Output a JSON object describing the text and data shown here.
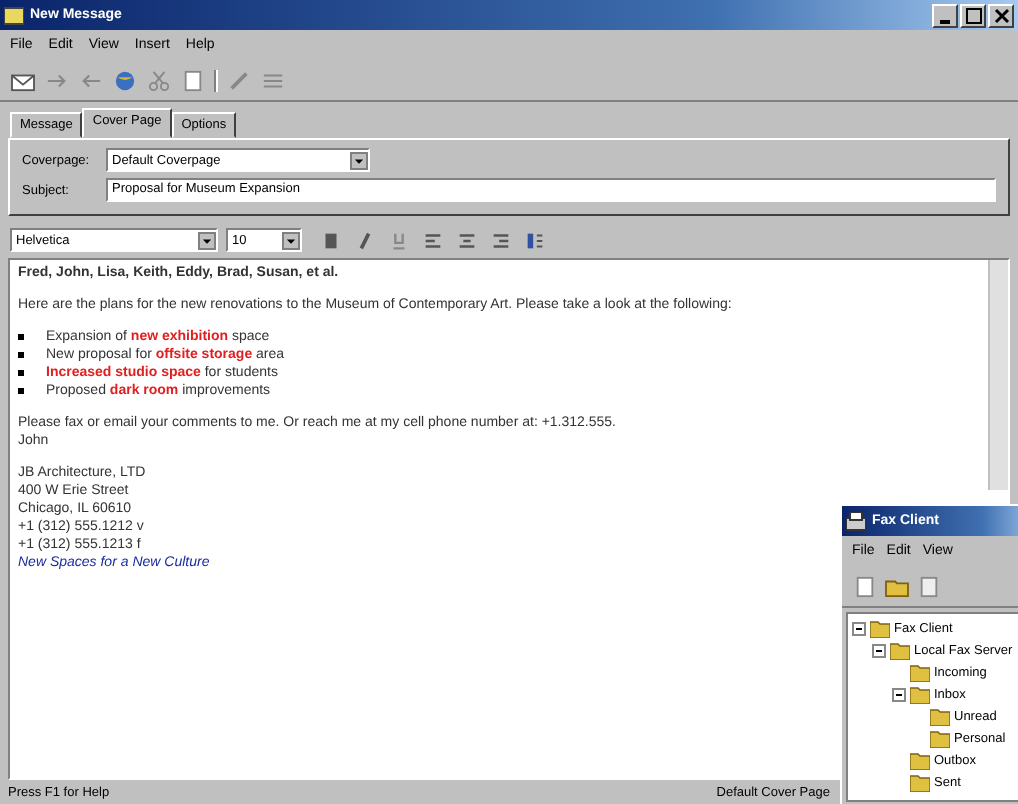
{
  "window": {
    "title": "New Message"
  },
  "menu": [
    "File",
    "Edit",
    "View",
    "Insert",
    "Help"
  ],
  "tabs": [
    {
      "label": "Message",
      "selected": false
    },
    {
      "label": "Cover Page",
      "selected": true
    },
    {
      "label": "Options",
      "selected": false
    }
  ],
  "cover_page": {
    "label": "Coverpage:",
    "value": "Default Coverpage"
  },
  "subject": {
    "label": "Subject:",
    "value": "Proposal for Museum Expansion"
  },
  "format_bar": {
    "font": "Helvetica",
    "size": "10"
  },
  "body": {
    "greeting": "Fred, John, Lisa, Keith, Eddy, Brad, Susan, et al.",
    "intro": "Here are the plans for the new renovations to the Museum of Contemporary Art. Please take a look at the following:",
    "bullets": [
      [
        {
          "text": "Expansion of ",
          "highlight": false
        },
        {
          "text": "new exhibition",
          "highlight": true
        },
        {
          "text": " space",
          "highlight": false
        }
      ],
      [
        {
          "text": "New proposal for ",
          "highlight": false
        },
        {
          "text": "offsite storage",
          "highlight": true
        },
        {
          "text": " area",
          "highlight": false
        }
      ],
      [
        {
          "text": "Increased studio space",
          "highlight": true
        },
        {
          "text": " for students",
          "highlight": false
        }
      ],
      [
        {
          "text": "Proposed ",
          "highlight": false
        },
        {
          "text": "dark room",
          "highlight": true
        },
        {
          "text": " improvements",
          "highlight": false
        }
      ]
    ],
    "closing": "Please fax or email your comments to me. Or reach me at my cell phone number at: +1.312.555.",
    "sign": "John",
    "signature": [
      "JB Architecture, LTD",
      "400 W Erie Street",
      "Chicago, IL 60610",
      "+1 (312) 555.1212 v",
      "+1 (312) 555.1213 f"
    ],
    "link": "New Spaces for a New Culture"
  },
  "status_bar": [
    "Press F1 for Help",
    "Default Cover Page"
  ],
  "fax_window": {
    "title": "Fax Client",
    "menu": [
      "File",
      "Edit",
      "View"
    ],
    "tree": [
      {
        "label": "Fax Client",
        "expanded": true,
        "children": [
          {
            "label": "Local Fax Server",
            "expanded": true,
            "children": [
              {
                "label": "Incoming"
              },
              {
                "label": "Inbox",
                "expanded": true,
                "children": [
                  {
                    "label": "Unread"
                  },
                  {
                    "label": "Personal"
                  }
                ]
              },
              {
                "label": "Outbox"
              },
              {
                "label": "Sent"
              }
            ]
          }
        ]
      }
    ]
  }
}
